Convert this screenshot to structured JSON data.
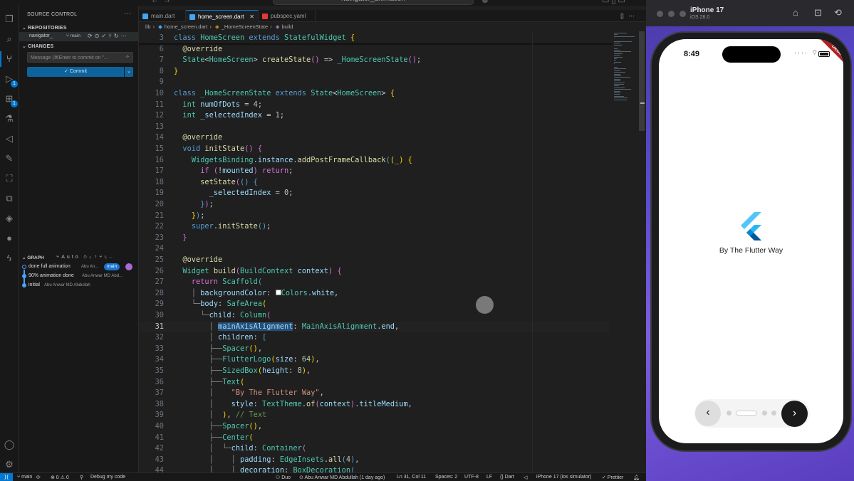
{
  "window": {
    "search": "navigator_animation",
    "nav_back": "←",
    "nav_forward": "→"
  },
  "activity_bar": {
    "badges": {
      "run": "1",
      "extensions": "1"
    }
  },
  "sidebar": {
    "title": "SOURCE CONTROL",
    "repositories_label": "REPOSITORIES",
    "repo": {
      "name": "navigator_",
      "branch": "main"
    },
    "changes_label": "CHANGES",
    "message_placeholder": "Message (⌘Enter to commit on \"...",
    "commit_label": "✓ Commit",
    "graph": {
      "label": "GRAPH",
      "mode": "Auto",
      "commits": [
        {
          "message": "done full animation",
          "author": "Abu An...",
          "badge": "main"
        },
        {
          "message": "90% animation done",
          "author": "Abu Anwar MD Abd..."
        },
        {
          "message": "initial",
          "author": "Abu Anwar MD Abdullah"
        }
      ]
    }
  },
  "tabs": [
    {
      "label": "main.dart",
      "active": false,
      "color": "#42a5f5"
    },
    {
      "label": "home_screen.dart",
      "active": true,
      "color": "#42a5f5"
    },
    {
      "label": "pubspec.yaml",
      "active": false,
      "color": "#e53935"
    }
  ],
  "breadcrumbs": [
    "lib",
    "home_screen.dart",
    "_HomeScreenState",
    "build"
  ],
  "code_lines": [
    {
      "n": "3",
      "html": "<span class=\"kw\">class</span> <span class=\"ty\">HomeScreen</span> <span class=\"kw\">extends</span> <span class=\"ty\">StatefulWidget</span> <span class=\"pn\">{</span>"
    },
    {
      "n": "6",
      "html": "  <span class=\"an\">@override</span>"
    },
    {
      "n": "7",
      "html": "  <span class=\"ty\">State</span>&lt;<span class=\"ty\">HomeScreen</span>&gt; <span class=\"fn\">createState</span><span class=\"pr\">()</span> =&gt; <span class=\"ty\">_HomeScreenState</span><span class=\"pr\">()</span>;"
    },
    {
      "n": "8",
      "html": "<span class=\"pn\">}</span>"
    },
    {
      "n": "9",
      "html": ""
    },
    {
      "n": "10",
      "html": "<span class=\"kw\">class</span> <span class=\"ty\">_HomeScreenState</span> <span class=\"kw\">extends</span> <span class=\"ty\">State</span>&lt;<span class=\"ty\">HomeScreen</span>&gt; <span class=\"pn\">{</span>"
    },
    {
      "n": "11",
      "html": "  <span class=\"ty\">int</span> <span class=\"vr\">numOfDots</span> = <span class=\"nm\">4</span>;"
    },
    {
      "n": "12",
      "html": "  <span class=\"ty\">int</span> <span class=\"vr\">_selectedIndex</span> = <span class=\"nm\">1</span>;"
    },
    {
      "n": "13",
      "html": ""
    },
    {
      "n": "14",
      "html": "  <span class=\"an\">@override</span>"
    },
    {
      "n": "15",
      "html": "  <span class=\"kw\">void</span> <span class=\"fn\">initState</span><span class=\"pr\">()</span> <span class=\"pr\">{</span>"
    },
    {
      "n": "16",
      "html": "    <span class=\"ty\">WidgetsBinding</span>.<span class=\"vr\">instance</span>.<span class=\"fn\">addPostFrameCallback</span><span class=\"kw\">(</span><span class=\"pn\">(_)</span> <span class=\"pn\">{</span>"
    },
    {
      "n": "17",
      "html": "      <span class=\"pr\">if</span> <span class=\"pr\">(</span>!<span class=\"vr\">mounted</span><span class=\"pr\">)</span> <span class=\"pr\">return</span>;"
    },
    {
      "n": "18",
      "html": "      <span class=\"fn\">setState</span><span class=\"pr\">(</span><span class=\"kw\">()</span> <span class=\"kw\">{</span>"
    },
    {
      "n": "19",
      "html": "        <span class=\"vr\">_selectedIndex</span> = <span class=\"nm\">0</span>;"
    },
    {
      "n": "20",
      "html": "      <span class=\"kw\">}</span><span class=\"pr\">)</span>;"
    },
    {
      "n": "21",
      "html": "    <span class=\"pn\">}</span><span class=\"kw\">)</span>;"
    },
    {
      "n": "22",
      "html": "    <span class=\"kw\">super</span>.<span class=\"fn\">initState</span><span class=\"kw\">()</span>;"
    },
    {
      "n": "23",
      "html": "  <span class=\"pr\">}</span>"
    },
    {
      "n": "24",
      "html": ""
    },
    {
      "n": "25",
      "html": "  <span class=\"an\">@override</span>"
    },
    {
      "n": "26",
      "html": "  <span class=\"ty\">Widget</span> <span class=\"fn\">build</span><span class=\"pr\">(</span><span class=\"ty\">BuildContext</span> <span class=\"vr\">context</span><span class=\"pr\">)</span> <span class=\"pr\">{</span>"
    },
    {
      "n": "27",
      "html": "    <span class=\"pr\">return</span> <span class=\"ty\">Scaffold</span><span class=\"kw\">(</span>"
    },
    {
      "n": "28",
      "html": "    <span class=\"gd\">│</span> <span class=\"vr\">backgroundColor</span>: <span style=\"display:inline-block;width:8px;height:8px;background:#fff;border:1px solid #888\"></span><span class=\"ty\">Colors</span>.<span class=\"vr\">white</span>,"
    },
    {
      "n": "29",
      "html": "    <span class=\"gd\">└─</span><span class=\"vr\">body</span>: <span class=\"ty\">SafeArea</span><span class=\"pn\">(</span>"
    },
    {
      "n": "30",
      "html": "      <span class=\"gd\">└─</span><span class=\"vr\">child</span>: <span class=\"ty\">Column</span><span class=\"pr\">(</span>"
    },
    {
      "n": "31",
      "html": "        <span class=\"gd\">│</span> <span class=\"vr sel\">mainAxisAlignment</span>: <span class=\"ty\">MainAxisAlignment</span>.<span class=\"vr\">end</span>,",
      "current": true
    },
    {
      "n": "32",
      "html": "        <span class=\"gd\">│</span> <span class=\"vr\">children</span>: <span class=\"kw\">[</span>"
    },
    {
      "n": "33",
      "html": "        <span class=\"gd\">├──</span><span class=\"ty\">Spacer</span><span class=\"pn\">()</span>,"
    },
    {
      "n": "34",
      "html": "        <span class=\"gd\">├──</span><span class=\"ty\">FlutterLogo</span><span class=\"pn\">(</span><span class=\"vr\">size</span>: <span class=\"nm\">64</span><span class=\"pn\">)</span>,"
    },
    {
      "n": "35",
      "html": "        <span class=\"gd\">├──</span><span class=\"ty\">SizedBox</span><span class=\"pn\">(</span><span class=\"vr\">height</span>: <span class=\"nm\">8</span><span class=\"pn\">)</span>,"
    },
    {
      "n": "36",
      "html": "        <span class=\"gd\">├──</span><span class=\"ty\">Text</span><span class=\"pn\">(</span>"
    },
    {
      "n": "37",
      "html": "        <span class=\"gd\">│</span>    <span class=\"st\">\"By The Flutter Way\"</span>,"
    },
    {
      "n": "38",
      "html": "        <span class=\"gd\">│</span>    <span class=\"vr\">style</span>: <span class=\"ty\">TextTheme</span>.<span class=\"fn\">of</span><span class=\"pr\">(</span><span class=\"vr\">context</span><span class=\"pr\">)</span>.<span class=\"vr\">titleMedium</span>,"
    },
    {
      "n": "39",
      "html": "        <span class=\"gd\">│</span>  <span class=\"pn\">)</span>, <span class=\"cm\">// Text</span>"
    },
    {
      "n": "40",
      "html": "        <span class=\"gd\">├──</span><span class=\"ty\">Spacer</span><span class=\"pn\">()</span>,"
    },
    {
      "n": "41",
      "html": "        <span class=\"gd\">├──</span><span class=\"ty\">Center</span><span class=\"pn\">(</span>"
    },
    {
      "n": "42",
      "html": "        <span class=\"gd\">│</span>  <span class=\"gd\">└─</span><span class=\"vr\">child</span>: <span class=\"ty\">Container</span><span class=\"pr\">(</span>"
    },
    {
      "n": "43",
      "html": "        <span class=\"gd\">│</span>    <span class=\"gd\">│</span> <span class=\"vr\">padding</span>: <span class=\"ty\">EdgeInsets</span>.<span class=\"fn\">all</span><span class=\"kw\">(</span><span class=\"nm\">4</span><span class=\"kw\">)</span>,"
    },
    {
      "n": "44",
      "html": "        <span class=\"gd\">│</span>    <span class=\"gd\">│</span> <span class=\"vr\">decoration</span>: <span class=\"ty\">BoxDecoration</span><span class=\"kw\">(</span>"
    }
  ],
  "statusbar": {
    "branch": "main",
    "sync": "⟳",
    "problems": "⊗ 0 ⚠ 0",
    "debug": "Debug my code",
    "duo": "Duo",
    "author": "Abu Anwar MD Abdullah (1 day ago)",
    "position": "Ln 31, Col 11",
    "spaces": "Spaces: 2",
    "encoding": "UTF-8",
    "eol": "LF",
    "language": "Dart",
    "device": "iPhone 17 (ios simulator)",
    "formatter": "Prettier"
  },
  "simulator": {
    "device_name": "iPhone 17",
    "os": "iOS 26.0",
    "time": "8:49",
    "debug_label": "DEBUG",
    "app_text": "By The Flutter Way",
    "num_dots": 4,
    "selected_index": 1
  }
}
